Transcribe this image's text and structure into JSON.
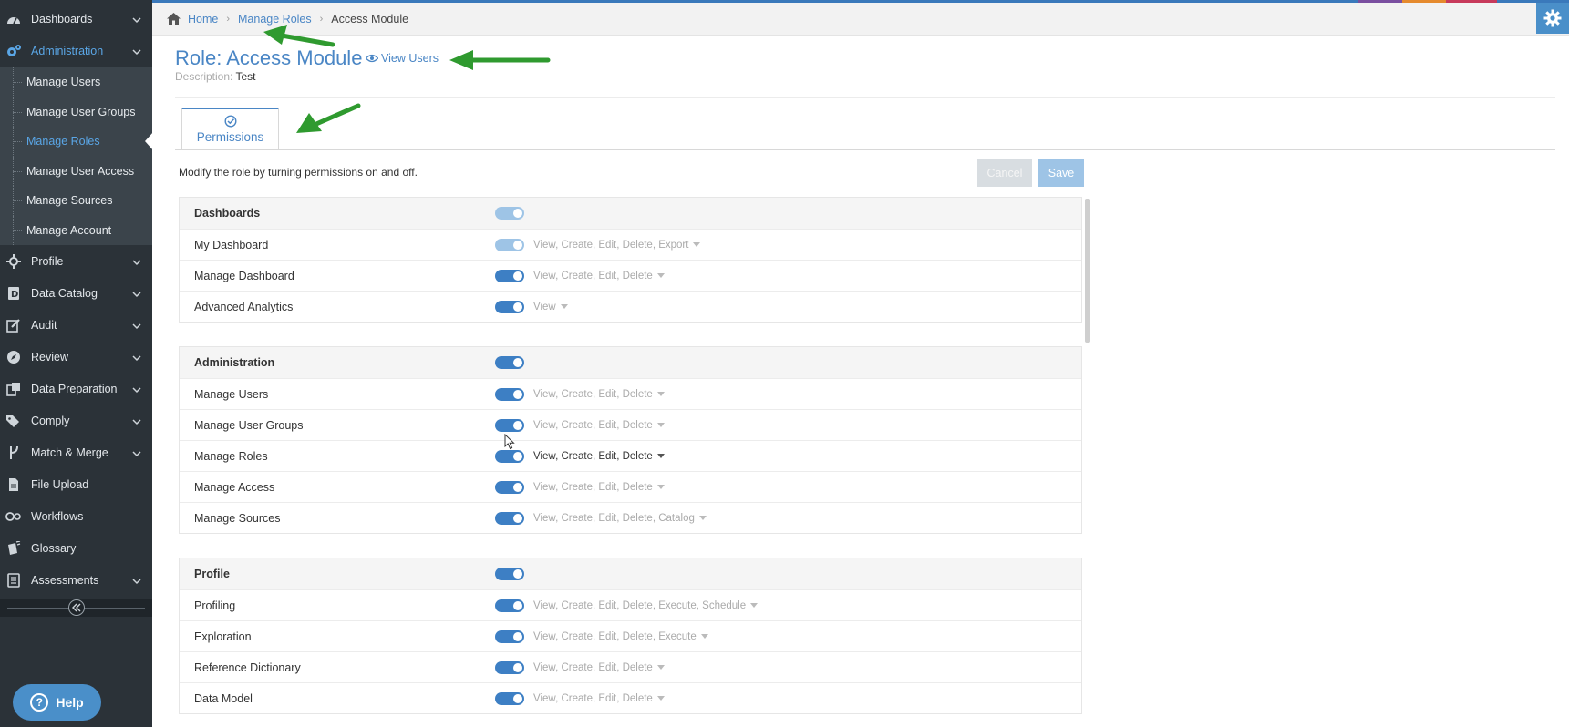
{
  "sidebar": {
    "items": [
      {
        "label": "Dashboards",
        "icon": "dashboard-icon",
        "has_chevron": true
      },
      {
        "label": "Administration",
        "icon": "cogs-icon",
        "has_chevron": true,
        "active": true
      },
      {
        "label": "Profile",
        "icon": "profile-icon",
        "has_chevron": true
      },
      {
        "label": "Data Catalog",
        "icon": "data-catalog-icon",
        "has_chevron": true
      },
      {
        "label": "Audit",
        "icon": "audit-icon",
        "has_chevron": true
      },
      {
        "label": "Review",
        "icon": "review-icon",
        "has_chevron": true
      },
      {
        "label": "Data Preparation",
        "icon": "data-preparation-icon",
        "has_chevron": true
      },
      {
        "label": "Comply",
        "icon": "tags-icon",
        "has_chevron": true
      },
      {
        "label": "Match & Merge",
        "icon": "merge-icon",
        "has_chevron": true
      },
      {
        "label": "File Upload",
        "icon": "file-icon",
        "has_chevron": false
      },
      {
        "label": "Workflows",
        "icon": "workflows-icon",
        "has_chevron": false
      },
      {
        "label": "Glossary",
        "icon": "glossary-icon",
        "has_chevron": false
      },
      {
        "label": "Assessments",
        "icon": "assessments-icon",
        "has_chevron": true
      }
    ],
    "admin_sub": [
      {
        "label": "Manage Users"
      },
      {
        "label": "Manage User Groups"
      },
      {
        "label": "Manage Roles",
        "active": true
      },
      {
        "label": "Manage User Access"
      },
      {
        "label": "Manage Sources"
      },
      {
        "label": "Manage Account"
      }
    ],
    "help_label": "Help"
  },
  "breadcrumb": {
    "home": "Home",
    "parent": "Manage Roles",
    "current": "Access Module"
  },
  "header": {
    "title": "Role: Access Module",
    "view_users": "View Users",
    "desc_label": "Description:",
    "desc_value": "Test"
  },
  "tabs": [
    {
      "label": "Permissions",
      "icon": "check-circle-icon"
    }
  ],
  "instruction": "Modify the role by turning permissions on and off.",
  "buttons": {
    "cancel": "Cancel",
    "save": "Save"
  },
  "groups": [
    {
      "name": "Dashboards",
      "enabled_style": "light",
      "rows": [
        {
          "name": "My Dashboard",
          "perms": "View, Create, Edit, Delete, Export",
          "toggle": "light"
        },
        {
          "name": "Manage Dashboard",
          "perms": "View, Create, Edit, Delete",
          "toggle": "on"
        },
        {
          "name": "Advanced Analytics",
          "perms": "View",
          "toggle": "on"
        }
      ]
    },
    {
      "name": "Administration",
      "enabled_style": "on",
      "rows": [
        {
          "name": "Manage Users",
          "perms": "View, Create, Edit, Delete",
          "toggle": "on"
        },
        {
          "name": "Manage User Groups",
          "perms": "View, Create, Edit, Delete",
          "toggle": "on"
        },
        {
          "name": "Manage Roles",
          "perms": "View, Create, Edit, Delete",
          "toggle": "on",
          "highlight": true
        },
        {
          "name": "Manage Access",
          "perms": "View, Create, Edit, Delete",
          "toggle": "on"
        },
        {
          "name": "Manage Sources",
          "perms": "View, Create, Edit, Delete, Catalog",
          "toggle": "on"
        }
      ]
    },
    {
      "name": "Profile",
      "enabled_style": "on",
      "rows": [
        {
          "name": "Profiling",
          "perms": "View, Create, Edit, Delete, Execute, Schedule",
          "toggle": "on"
        },
        {
          "name": "Exploration",
          "perms": "View, Create, Edit, Delete, Execute",
          "toggle": "on"
        },
        {
          "name": "Reference Dictionary",
          "perms": "View, Create, Edit, Delete",
          "toggle": "on"
        },
        {
          "name": "Data Model",
          "perms": "View, Create, Edit, Delete",
          "toggle": "on"
        }
      ]
    }
  ],
  "colors": {
    "sidebar_bg": "#2b3238",
    "accent": "#4a86c5",
    "toggle_on": "#3d7fc4",
    "annotation_arrow": "#2f9a2f"
  }
}
